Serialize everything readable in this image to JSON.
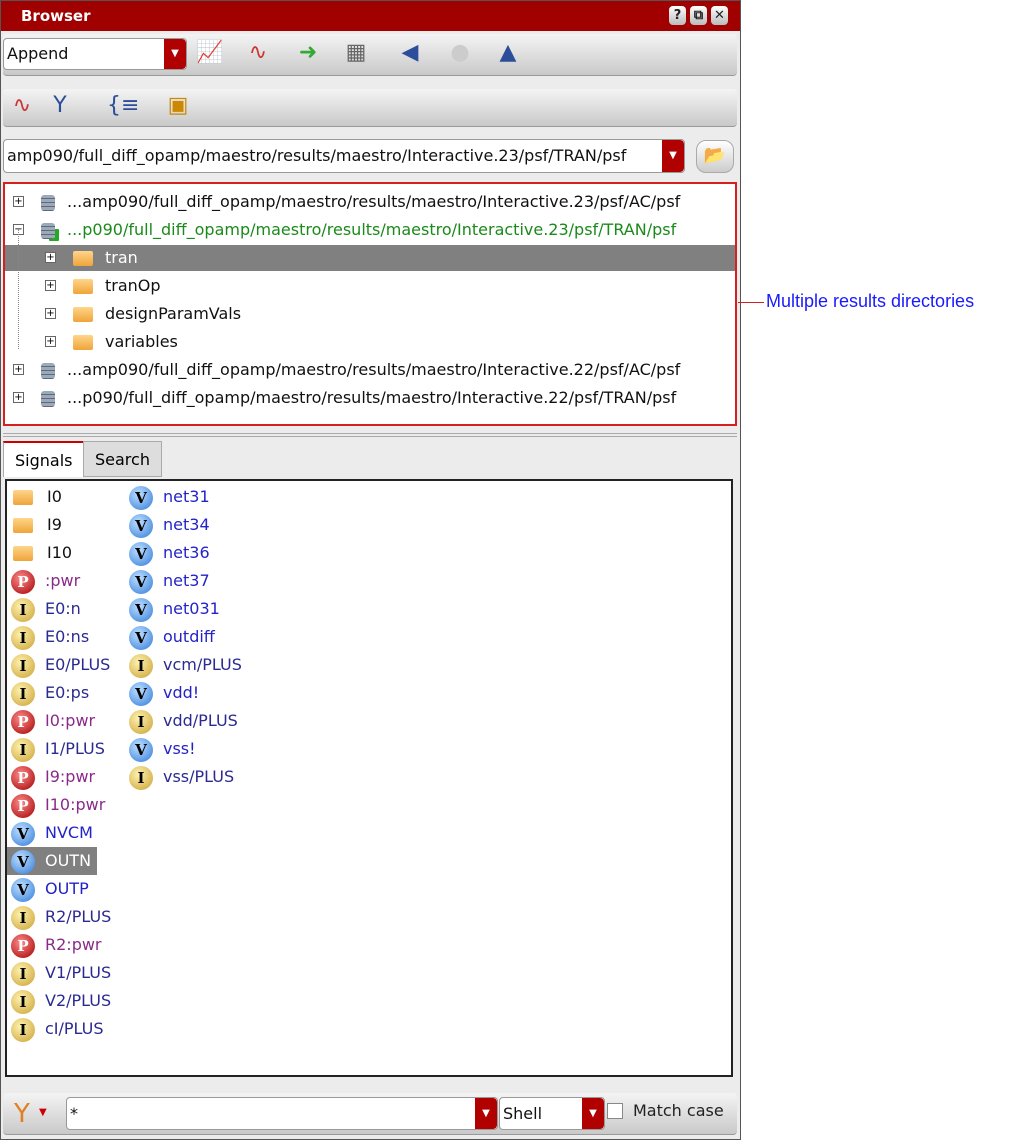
{
  "window": {
    "title": "Browser",
    "help": "?",
    "restore": "⧉",
    "close": "✕"
  },
  "toolbar": {
    "mode": "Append",
    "path": "amp090/full_diff_opamp/maestro/results/maestro/Interactive.23/psf/TRAN/psf"
  },
  "tree": [
    {
      "label": "...amp090/full_diff_opamp/maestro/results/maestro/Interactive.23/psf/AC/psf",
      "level": 0,
      "kind": "db",
      "expanded": false,
      "color": "#111111"
    },
    {
      "label": "...p090/full_diff_opamp/maestro/results/maestro/Interactive.23/psf/TRAN/psf",
      "level": 0,
      "kind": "db-check",
      "expanded": true,
      "color": "#1a8a1a"
    },
    {
      "label": "tran",
      "level": 1,
      "kind": "folder",
      "selected": true,
      "color": "#ffffff"
    },
    {
      "label": "tranOp",
      "level": 1,
      "kind": "folder",
      "color": "#111111"
    },
    {
      "label": "designParamVals",
      "level": 1,
      "kind": "folder",
      "color": "#111111"
    },
    {
      "label": "variables",
      "level": 1,
      "kind": "folder",
      "color": "#111111"
    },
    {
      "label": "...amp090/full_diff_opamp/maestro/results/maestro/Interactive.22/psf/AC/psf",
      "level": 0,
      "kind": "db",
      "color": "#111111"
    },
    {
      "label": "...p090/full_diff_opamp/maestro/results/maestro/Interactive.22/psf/TRAN/psf",
      "level": 0,
      "kind": "db",
      "color": "#111111"
    }
  ],
  "tabs": [
    "Signals",
    "Search"
  ],
  "signals": [
    [
      [
        "folder",
        "I0"
      ],
      [
        "folder",
        "I9"
      ],
      [
        "folder",
        "I10"
      ],
      [
        "P",
        ":pwr"
      ],
      [
        "I",
        "E0:n"
      ],
      [
        "I",
        "E0:ns"
      ],
      [
        "I",
        "E0/PLUS"
      ],
      [
        "I",
        "E0:ps"
      ],
      [
        "P",
        "I0:pwr"
      ],
      [
        "I",
        "I1/PLUS"
      ],
      [
        "P",
        "I9:pwr"
      ],
      [
        "P",
        "I10:pwr"
      ],
      [
        "V",
        "NVCM"
      ],
      [
        "V",
        "OUTN"
      ],
      [
        "V",
        "OUTP"
      ],
      [
        "I",
        "R2/PLUS"
      ],
      [
        "P",
        "R2:pwr"
      ],
      [
        "I",
        "V1/PLUS"
      ],
      [
        "I",
        "V2/PLUS"
      ],
      [
        "I",
        "cI/PLUS"
      ]
    ],
    [
      [
        "V",
        "net31"
      ],
      [
        "V",
        "net34"
      ],
      [
        "V",
        "net36"
      ],
      [
        "V",
        "net37"
      ],
      [
        "V",
        "net031"
      ],
      [
        "V",
        "outdiff"
      ],
      [
        "I",
        "vcm/PLUS"
      ],
      [
        "V",
        "vdd!"
      ],
      [
        "I",
        "vdd/PLUS"
      ],
      [
        "V",
        "vss!"
      ],
      [
        "I",
        "vss/PLUS"
      ]
    ]
  ],
  "selected_signal": "OUTN",
  "colors": {
    "V": "#2323c8",
    "I": "#2a2a90",
    "P": "#8a2a8a",
    "folder": "#111111"
  },
  "filter": {
    "value": "*",
    "type": "Shell",
    "match_case_label": "Match case"
  },
  "annotation": "Multiple results directories"
}
